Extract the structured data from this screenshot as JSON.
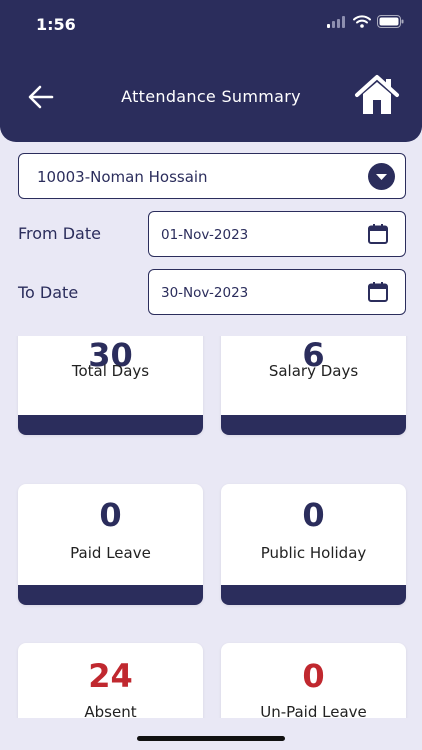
{
  "status_bar": {
    "time": "1:56"
  },
  "header": {
    "title": "Attendance Summary"
  },
  "employee_select": {
    "value": "10003-Noman Hossain"
  },
  "filters": {
    "from_label": "From Date",
    "from_value": "01-Nov-2023",
    "to_label": "To Date",
    "to_value": "30-Nov-2023"
  },
  "cards": [
    {
      "value": "30",
      "label": "Total Days"
    },
    {
      "value": "6",
      "label": "Salary Days"
    },
    {
      "value": "0",
      "label": "Paid Leave"
    },
    {
      "value": "0",
      "label": "Public Holiday"
    },
    {
      "value": "24",
      "label": "Absent"
    },
    {
      "value": "0",
      "label": "Un-Paid Leave"
    }
  ],
  "colors": {
    "primary": "#2b2d5c",
    "background": "#e9e8f5",
    "absent_value": "#c0282f"
  }
}
